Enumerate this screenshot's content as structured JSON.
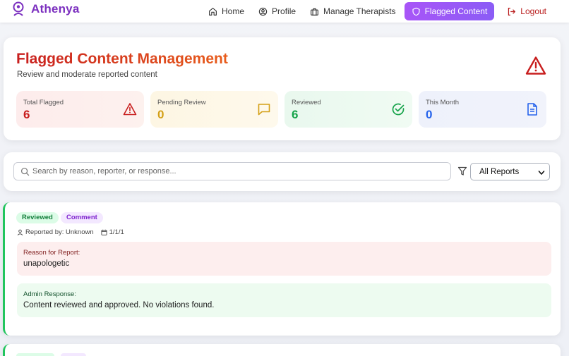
{
  "brand": {
    "name": "Athenya"
  },
  "nav": {
    "items": [
      {
        "label": "Home",
        "icon": "home-icon"
      },
      {
        "label": "Profile",
        "icon": "profile-icon"
      },
      {
        "label": "Manage Therapists",
        "icon": "briefcase-icon"
      },
      {
        "label": "Flagged Content",
        "icon": "shield-icon",
        "active": true
      },
      {
        "label": "Logout",
        "icon": "logout-icon"
      }
    ],
    "active_color": "#8b5cf6"
  },
  "header": {
    "title": "Flagged Content Management",
    "subtitle": "Review and moderate reported content",
    "icon": "warning-icon"
  },
  "stats": [
    {
      "label": "Total Flagged",
      "value": "6",
      "icon": "warning-icon",
      "color": "#c81e1e"
    },
    {
      "label": "Pending Review",
      "value": "0",
      "icon": "message-icon",
      "color": "#d4a017"
    },
    {
      "label": "Reviewed",
      "value": "6",
      "icon": "check-circle-icon",
      "color": "#16a34a"
    },
    {
      "label": "This Month",
      "value": "0",
      "icon": "document-icon",
      "color": "#2563eb"
    }
  ],
  "search": {
    "placeholder": "Search by reason, reporter, or response...",
    "value": ""
  },
  "filter": {
    "selected": "All Reports"
  },
  "reports": [
    {
      "status": "Reviewed",
      "type": "Comment",
      "reporter": "Reported by: Unknown",
      "date": "1/1/1",
      "reason_label": "Reason for Report:",
      "reason": "unapologetic",
      "response_label": "Admin Response:",
      "response": "Content reviewed and approved. No violations found.",
      "accent": "#22c55e"
    }
  ]
}
